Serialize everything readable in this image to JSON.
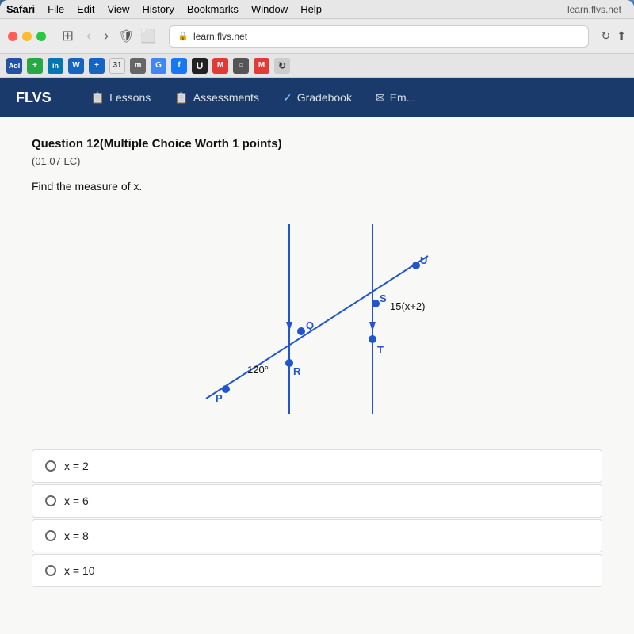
{
  "desktop": {
    "background": "macOS desktop"
  },
  "menu_bar": {
    "items": [
      "Safari",
      "File",
      "Edit",
      "View",
      "History",
      "Bookmarks",
      "Window",
      "Help"
    ],
    "url": "learn.flvs.net"
  },
  "toolbar": {
    "back_label": "‹",
    "forward_label": "›",
    "address": "learn.flvs.net"
  },
  "flvs_nav": {
    "logo": "FLVS",
    "items": [
      {
        "label": "Lessons",
        "icon": "📋"
      },
      {
        "label": "Assessments",
        "icon": "📋"
      },
      {
        "label": "Gradebook",
        "icon": "✓"
      },
      {
        "label": "Em...",
        "icon": "✉"
      }
    ]
  },
  "question": {
    "number": "Question 12",
    "type": "(Multiple Choice Worth 1 points)",
    "code": "(01.07 LC)",
    "prompt": "Find the measure of x.",
    "diagram": {
      "angle_label": "120°",
      "expression_label": "15(x+2)",
      "points": [
        "P",
        "Q",
        "R",
        "S",
        "T",
        "U"
      ]
    },
    "choices": [
      {
        "label": "x = 2"
      },
      {
        "label": "x = 6"
      },
      {
        "label": "x = 8"
      },
      {
        "label": "x = 10"
      }
    ]
  }
}
